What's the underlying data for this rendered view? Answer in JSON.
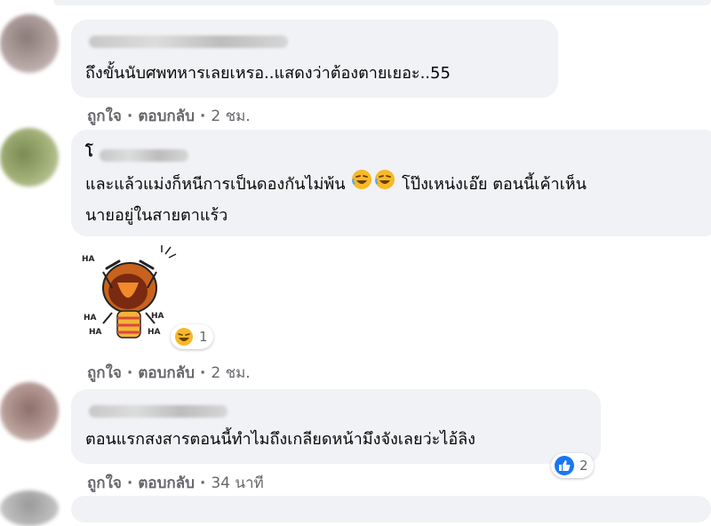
{
  "comments": [
    {
      "text": "ถึงขั้นนับศพทหารเลยเหรอ..แสดงว่าต้องตายเยอะ..55",
      "actions": {
        "like": "ถูกใจ",
        "reply": "ตอบกลับ",
        "sep": "·",
        "time": "2 ชม."
      }
    },
    {
      "name_initial": "โ",
      "text_line1_a": "และแล้วแม่งก็หนีการเป็นดองกันไม่พ้น",
      "text_line1_b": "โป๊งเหน่งเอ๊ย ตอนนี้เค้าเห็น",
      "text_line2": "นายอยู่ในสายตาแร้ว",
      "inline_emoji": "rolling-on-floor-laughing-icon",
      "sticker_label": "HA",
      "reaction": {
        "icon": "laughing-reaction-icon",
        "count": "1"
      },
      "actions": {
        "like": "ถูกใจ",
        "reply": "ตอบกลับ",
        "sep": "·",
        "time": "2 ชม."
      }
    },
    {
      "text": "ตอนแรกสงสารตอนนี้ทำไมถึงเกลียดหน้ามึงจังเลยว่ะไอ้ลิง",
      "reaction": {
        "icon": "like-reaction-icon",
        "count": "2"
      },
      "actions": {
        "like": "ถูกใจ",
        "reply": "ตอบกลับ",
        "sep": "·",
        "time": "34 นาที"
      }
    }
  ],
  "colors": {
    "bubble": "#f0f2f5",
    "meta": "#65676b",
    "like_blue": "#1877f2",
    "laugh_yellow": "#f7b928"
  }
}
